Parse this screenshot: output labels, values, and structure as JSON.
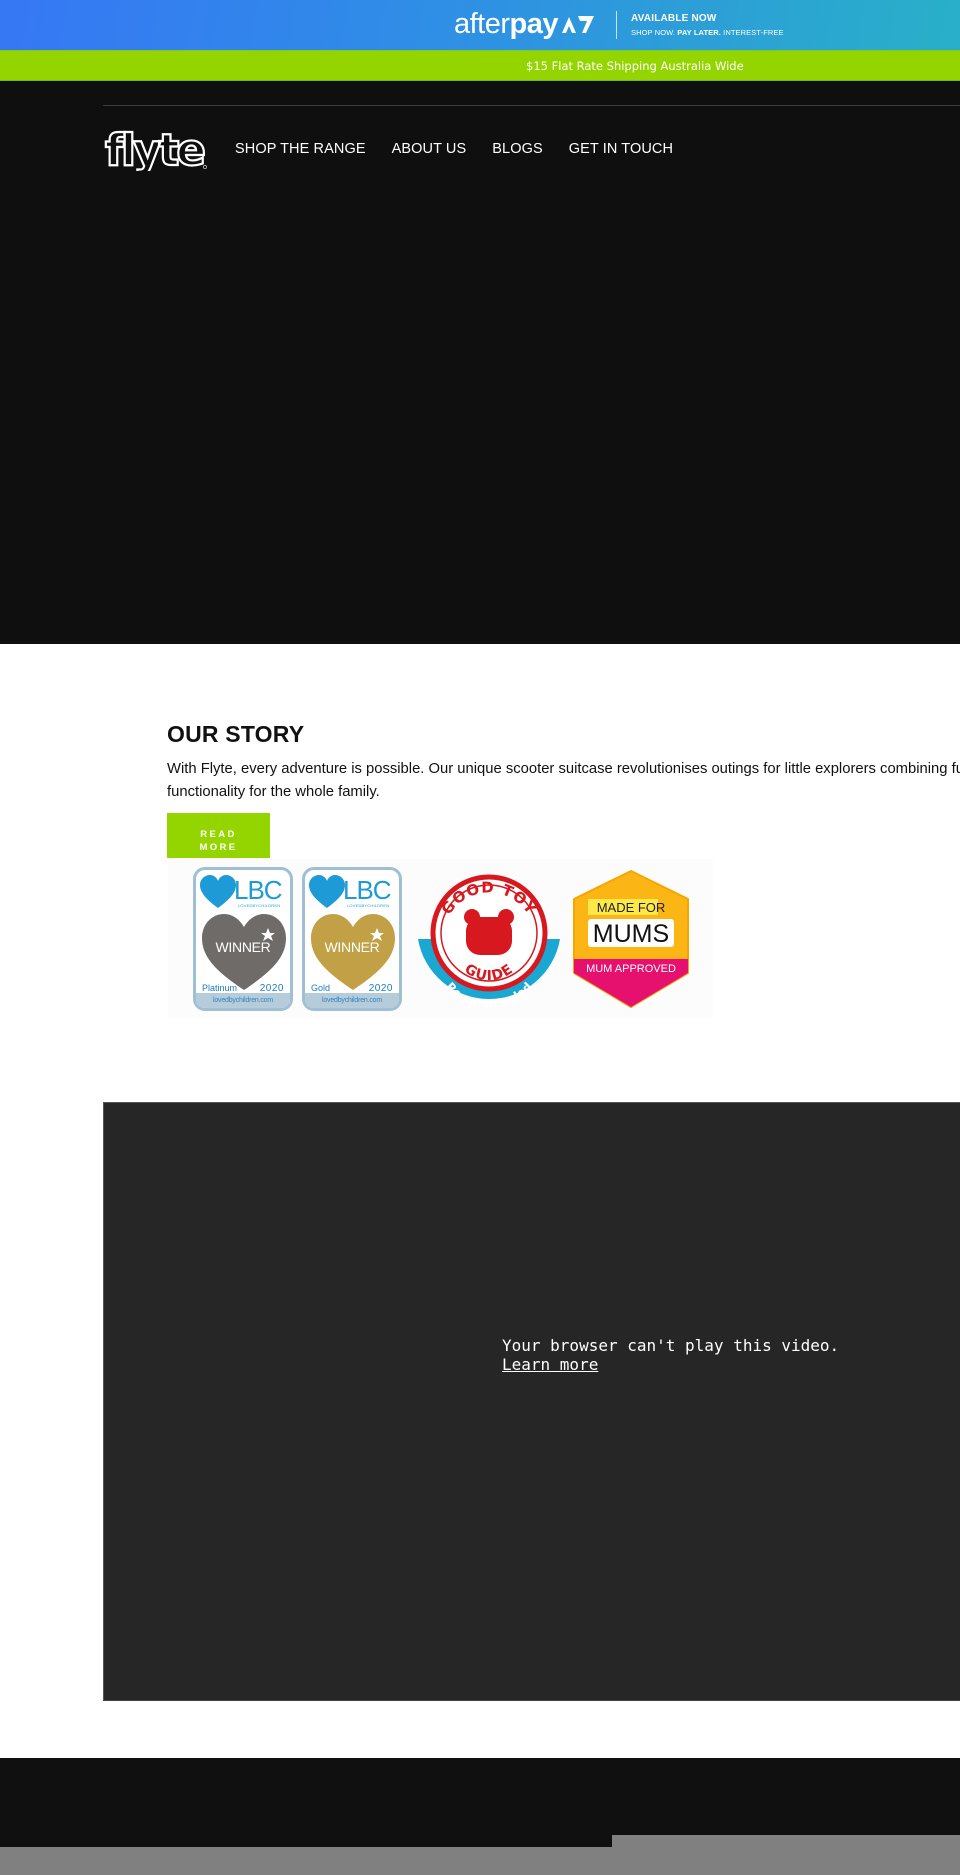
{
  "afterpay_banner": {
    "logo_light": "after",
    "logo_bold": "pay",
    "logo_icon": "afterpay-arrows-icon",
    "headline": "AVAILABLE NOW",
    "sub_prefix": "SHOP NOW.",
    "sub_bold": "PAY LATER.",
    "sub_suffix": "INTEREST-FREE"
  },
  "shipping_banner": {
    "text": "$15 Flat Rate Shipping Australia Wide"
  },
  "header": {
    "logo_text": "flyte",
    "nav": [
      {
        "label": "SHOP THE RANGE"
      },
      {
        "label": "ABOUT US"
      },
      {
        "label": "BLOGS"
      },
      {
        "label": "GET IN TOUCH"
      }
    ]
  },
  "story": {
    "title": "OUR STORY",
    "line1": "With Flyte, every adventure is possible. Our unique scooter suitcase revolutionises outings for little explorers combining fun",
    "line2": "functionality for the whole family.",
    "button_line1": "READ",
    "button_line2": "MORE"
  },
  "awards": [
    {
      "brand": "LBC",
      "brand_sub": "LOVEDBYCHILDREN",
      "title": "WINNER",
      "tier": "Platinum",
      "year": "2020",
      "site": "lovedbychildren.com",
      "heart_color": "#6f6b68"
    },
    {
      "brand": "LBC",
      "brand_sub": "LOVEDBYCHILDREN",
      "title": "WINNER",
      "tier": "Gold",
      "year": "2020",
      "site": "lovedbychildren.com",
      "heart_color": "#c2a046"
    },
    {
      "line1": "GOOD TOY",
      "line2": "GUIDE",
      "ribbon": "Recommended"
    },
    {
      "line1": "MADE FOR",
      "line2": "MUMS",
      "ribbon": "MUM APPROVED"
    }
  ],
  "video": {
    "message": "Your browser can't play this video.",
    "link": "Learn more"
  },
  "colors": {
    "accent_green": "#94d500",
    "hero_bg": "#0f0f0f",
    "video_bg": "#262626",
    "lbc_blue": "#1e9ad6"
  }
}
